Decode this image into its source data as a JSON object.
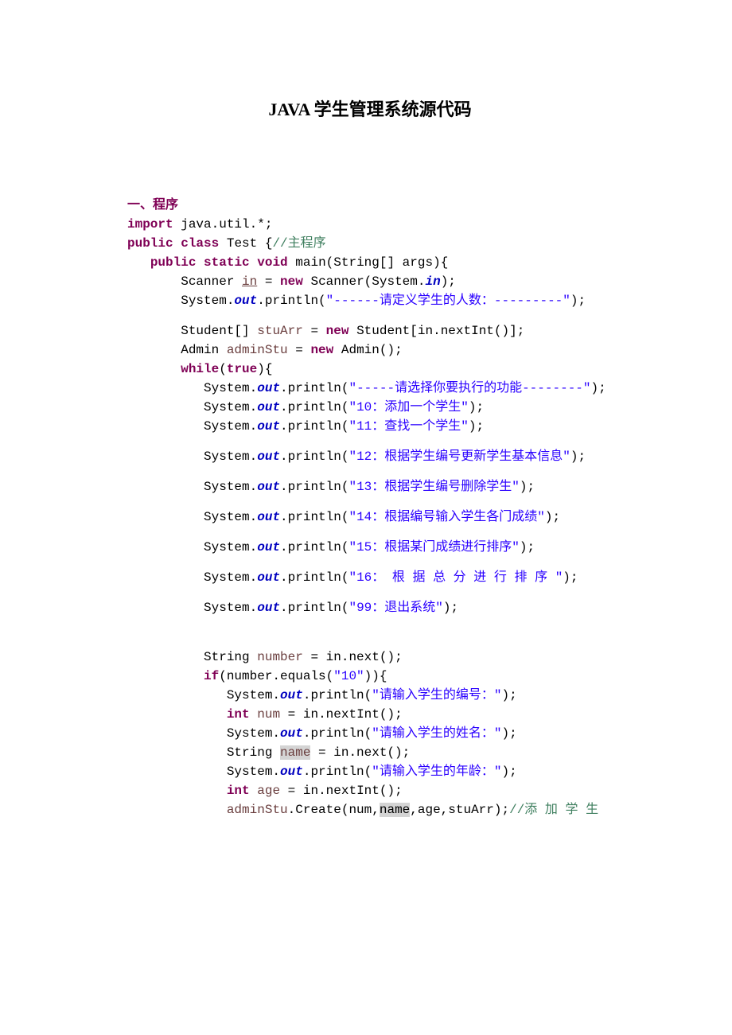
{
  "title": "JAVA 学生管理系统源代码",
  "section_label": "一、程序",
  "code": {
    "l1_kw1": "import",
    "l1_rest": " java.util.*;",
    "l2_kw1": "public",
    "l2_kw2": "class",
    "l2_txt": " Test {",
    "l2_cmt": "//主程序",
    "l3_kw1": "public",
    "l3_kw2": "static",
    "l3_kw3": "void",
    "l3_txt": " main(String[] args){",
    "l4_a": "       Scanner ",
    "l4_in": "in",
    "l4_b": " = ",
    "l4_kw": "new",
    "l4_c": " Scanner(System.",
    "l4_fld": "in",
    "l4_d": ");",
    "l5_a": "       System.",
    "l5_fld": "out",
    "l5_b": ".println(",
    "l5_str": "\"------请定义学生的人数：---------\"",
    "l5_c": ");",
    "l6_a": "       Student[] ",
    "l6_var": "stuArr",
    "l6_b": " = ",
    "l6_kw": "new",
    "l6_c": " Student[in.nextInt()];",
    "l7_a": "       Admin ",
    "l7_var": "adminStu",
    "l7_b": " = ",
    "l7_kw": "new",
    "l7_c": " Admin();",
    "l8_a": "       ",
    "l8_kw1": "while",
    "l8_b": "(",
    "l8_kw2": "true",
    "l8_c": "){",
    "l9_a": "          System.",
    "l9_fld": "out",
    "l9_b": ".println(",
    "l9_str": "\"-----请选择你要执行的功能--------\"",
    "l9_c": ");",
    "l10_a": "          System.",
    "l10_fld": "out",
    "l10_b": ".println(",
    "l10_str": "\"10：添加一个学生\"",
    "l10_c": ");",
    "l11_a": "          System.",
    "l11_fld": "out",
    "l11_b": ".println(",
    "l11_str": "\"11：查找一个学生\"",
    "l11_c": ");",
    "l12_a": "          System.",
    "l12_fld": "out",
    "l12_b": ".println(",
    "l12_str": "\"12：根据学生编号更新学生基本信息\"",
    "l12_c": ");",
    "l13_a": "          System.",
    "l13_fld": "out",
    "l13_b": ".println(",
    "l13_str": "\"13：根据学生编号删除学生\"",
    "l13_c": ");",
    "l14_a": "          System.",
    "l14_fld": "out",
    "l14_b": ".println(",
    "l14_str": "\"14：根据编号输入学生各门成绩\"",
    "l14_c": ");",
    "l15_a": "          System.",
    "l15_fld": "out",
    "l15_b": ".println(",
    "l15_str": "\"15：根据某门成绩进行排序\"",
    "l15_c": ");",
    "l16_a": "          System.",
    "l16_fld": "out",
    "l16_b": ".println(",
    "l16_str": "\"16： 根 据 总 分 进 行 排 序 \"",
    "l16_c": ");",
    "l17_a": "          System.",
    "l17_fld": "out",
    "l17_b": ".println(",
    "l17_str": "\"99：退出系统\"",
    "l17_c": ");",
    "l18_a": "          String ",
    "l18_var": "number",
    "l18_b": " = in.next();",
    "l19_a": "          ",
    "l19_kw": "if",
    "l19_b": "(number.equals(",
    "l19_str": "\"10\"",
    "l19_c": ")){",
    "l20_a": "             System.",
    "l20_fld": "out",
    "l20_b": ".println(",
    "l20_str": "\"请输入学生的编号：\"",
    "l20_c": ");",
    "l21_a": "             ",
    "l21_kw": "int",
    "l21_b": " ",
    "l21_var": "num",
    "l21_c": " = in.nextInt();",
    "l22_a": "             System.",
    "l22_fld": "out",
    "l22_b": ".println(",
    "l22_str": "\"请输入学生的姓名：\"",
    "l22_c": ");",
    "l23_a": "             String ",
    "l23_var": "name",
    "l23_b": " = in.next();",
    "l24_a": "             System.",
    "l24_fld": "out",
    "l24_b": ".println(",
    "l24_str": "\"请输入学生的年龄：\"",
    "l24_c": ");",
    "l25_a": "             ",
    "l25_kw": "int",
    "l25_b": " ",
    "l25_var": "age",
    "l25_c": " = in.nextInt();",
    "l26_a": "             ",
    "l26_var": "adminStu",
    "l26_b": ".Create(num,",
    "l26_name": "name",
    "l26_c": ",age,stuArr);",
    "l26_cmt": "//添 加 学 生"
  }
}
